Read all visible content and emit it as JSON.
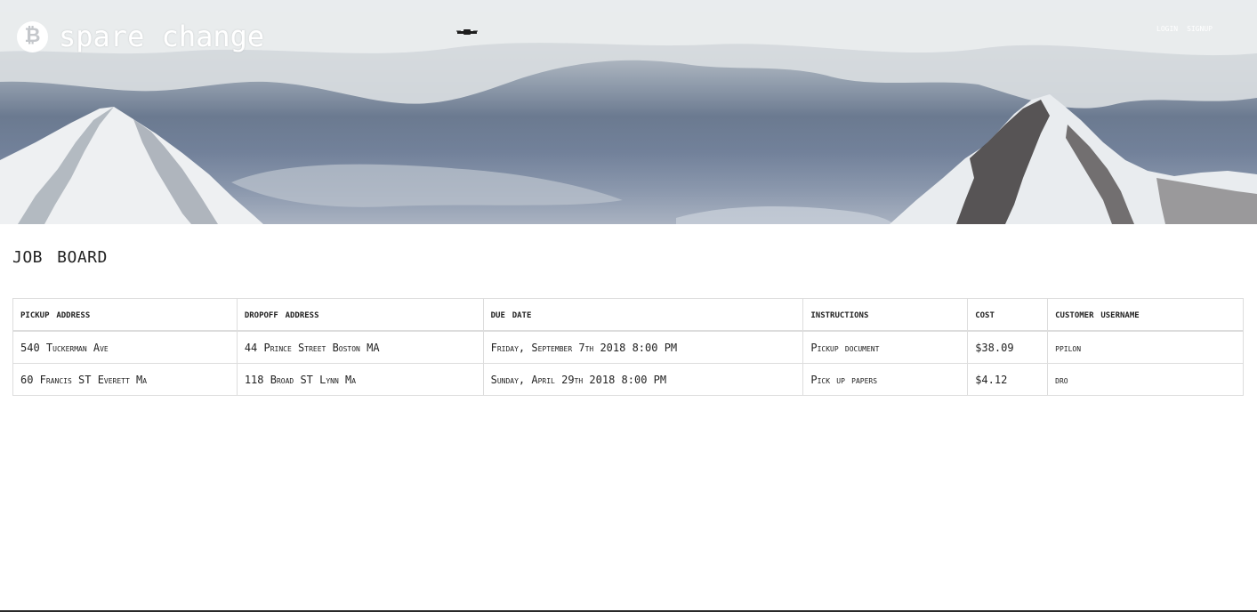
{
  "header": {
    "brand_icon": "bitcoin-icon",
    "brand_icon_glyph": "₿",
    "brand_name": "spare change",
    "nav": {
      "login_label": "Login",
      "signup_label": "Signup"
    }
  },
  "main": {
    "title": "Job Board",
    "table": {
      "columns": [
        "Pickup Address",
        "Dropoff Address",
        "Due Date",
        "Instructions",
        "Cost",
        "Customer Username"
      ],
      "rows": [
        [
          "540 Tuckerman Ave",
          "44 Prince Street Boston MA",
          "Friday, September 7th 2018 8:00 PM",
          "Pickup document",
          "$38.09",
          "ppilon"
        ],
        [
          "60 Francis ST Everett Ma",
          "118 Broad ST Lynn Ma",
          "Sunday, April 29th 2018 8:00 PM",
          "Pick up papers",
          "$4.12",
          "dro"
        ]
      ]
    }
  },
  "colors": {
    "sky": "#6b7a90",
    "clouds": "#e6e8ea",
    "text": "#222222",
    "border": "#dddddd"
  }
}
